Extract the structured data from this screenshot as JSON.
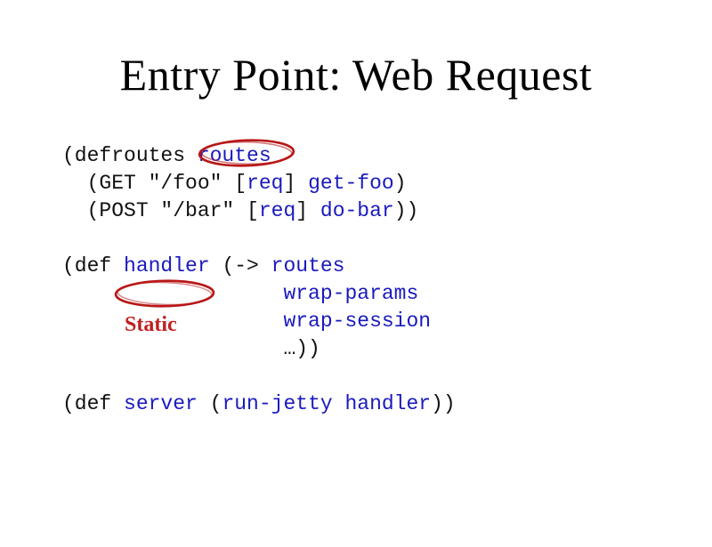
{
  "title": "Entry Point: Web Request",
  "annotation": {
    "static_label": "Static"
  },
  "code": {
    "line1": {
      "p1": "(defroutes ",
      "p2": "routes"
    },
    "line2": {
      "p1": "  (GET ",
      "p2": "\"/foo\"",
      "p3": " [",
      "p4": "req",
      "p5": "] ",
      "p6": "get-foo",
      "p7": ")"
    },
    "line3": {
      "p1": "  (POST ",
      "p2": "\"/bar\"",
      "p3": " [",
      "p4": "req",
      "p5": "] ",
      "p6": "do-bar",
      "p7": "))"
    },
    "line4": "",
    "line5": {
      "p1": "(def ",
      "p2": "handler",
      "p3": " (-> ",
      "p4": "routes"
    },
    "line6": {
      "p1": "                  ",
      "p2": "wrap-params"
    },
    "line7": {
      "p1": "                  ",
      "p2": "wrap-session"
    },
    "line8": {
      "p1": "                  …))"
    },
    "line9": "",
    "line10": {
      "p1": "(def ",
      "p2": "server",
      "p3": " (",
      "p4": "run-jetty handler",
      "p5": "))"
    }
  }
}
